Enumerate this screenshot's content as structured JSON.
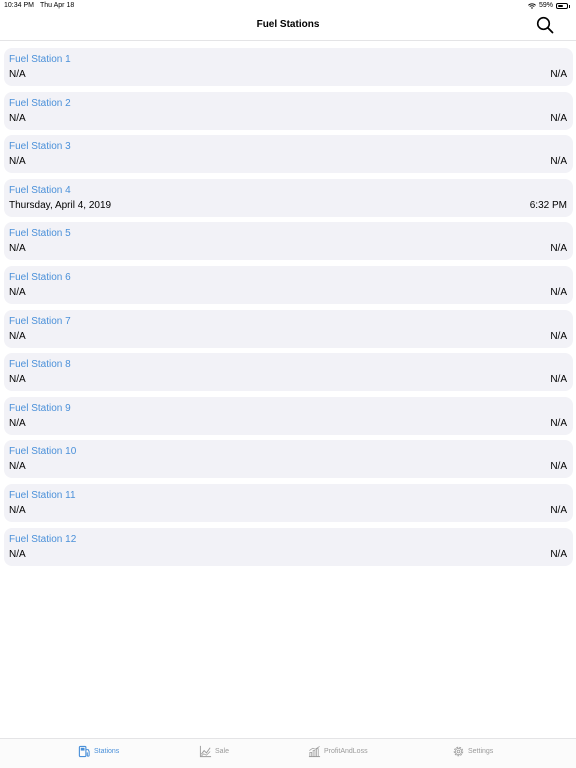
{
  "status_bar": {
    "time": "10:34 PM",
    "date": "Thu Apr 18",
    "battery": "59%",
    "battery_level": 0.59
  },
  "nav": {
    "title": "Fuel Stations",
    "search_icon": "search-icon"
  },
  "stations": [
    {
      "name": "Fuel Station 1",
      "date": "N/A",
      "time": "N/A"
    },
    {
      "name": "Fuel Station 2",
      "date": "N/A",
      "time": "N/A"
    },
    {
      "name": "Fuel Station 3",
      "date": "N/A",
      "time": "N/A"
    },
    {
      "name": "Fuel Station 4",
      "date": "Thursday, April 4, 2019",
      "time": "6:32 PM"
    },
    {
      "name": "Fuel Station 5",
      "date": "N/A",
      "time": "N/A"
    },
    {
      "name": "Fuel Station 6",
      "date": "N/A",
      "time": "N/A"
    },
    {
      "name": "Fuel Station 7",
      "date": "N/A",
      "time": "N/A"
    },
    {
      "name": "Fuel Station 8",
      "date": "N/A",
      "time": "N/A"
    },
    {
      "name": "Fuel Station 9",
      "date": "N/A",
      "time": "N/A"
    },
    {
      "name": "Fuel Station 10",
      "date": "N/A",
      "time": "N/A"
    },
    {
      "name": "Fuel Station 11",
      "date": "N/A",
      "time": "N/A"
    },
    {
      "name": "Fuel Station 12",
      "date": "N/A",
      "time": "N/A"
    }
  ],
  "tabs": [
    {
      "label": "Stations",
      "icon": "fuel-pump-icon",
      "active": true
    },
    {
      "label": "Sale",
      "icon": "chart-icon",
      "active": false
    },
    {
      "label": "ProfitAndLoss",
      "icon": "bar-chart-icon",
      "active": false
    },
    {
      "label": "Settings",
      "icon": "gear-icon",
      "active": false
    }
  ],
  "colors": {
    "accent": "#4a90d9",
    "card_background": "#f2f2f7",
    "inactive_tab": "#9a9a9a"
  }
}
